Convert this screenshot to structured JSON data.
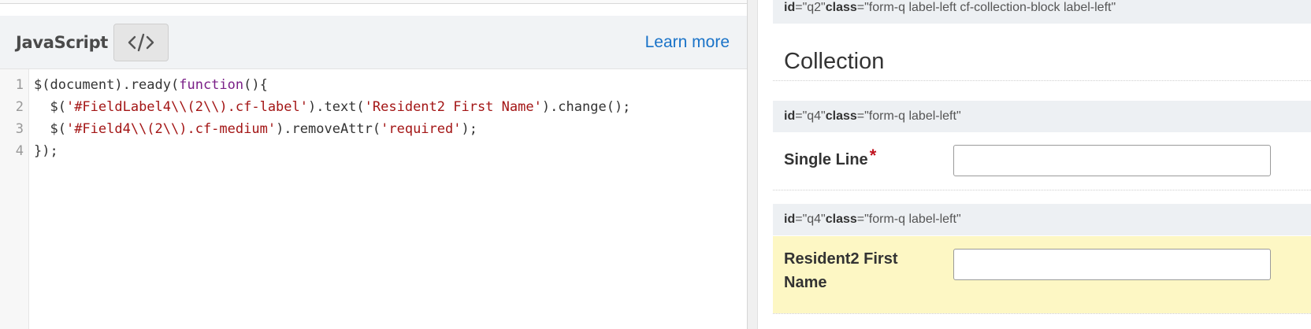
{
  "editor": {
    "title": "JavaScript",
    "toggle_icon": "code-brackets-icon",
    "learn_more": "Learn more",
    "line_numbers": [
      "1",
      "2",
      "3",
      "4"
    ],
    "lines": [
      [
        {
          "t": "$(document).ready(",
          "c": ""
        },
        {
          "t": "function",
          "c": "kw"
        },
        {
          "t": "(){",
          "c": ""
        }
      ],
      [
        {
          "t": "  $(",
          "c": ""
        },
        {
          "t": "'#FieldLabel4\\\\(2\\\\).cf-label'",
          "c": "str"
        },
        {
          "t": ").text(",
          "c": ""
        },
        {
          "t": "'Resident2 First Name'",
          "c": "str"
        },
        {
          "t": ").change();",
          "c": ""
        }
      ],
      [
        {
          "t": "  $(",
          "c": ""
        },
        {
          "t": "'#Field4\\\\(2\\\\).cf-medium'",
          "c": "str"
        },
        {
          "t": ").removeAttr(",
          "c": ""
        },
        {
          "t": "'required'",
          "c": "str"
        },
        {
          "t": ");",
          "c": ""
        }
      ],
      [
        {
          "t": "});",
          "c": ""
        }
      ]
    ]
  },
  "preview": {
    "meta_q2": {
      "id_key": "id",
      "id_val": "=\"q2\" ",
      "class_key": "class",
      "class_val": "=\"form-q label-left cf-collection-block label-left\""
    },
    "section_title": "Collection",
    "meta_q4a": {
      "id_key": "id",
      "id_val": "=\"q4\" ",
      "class_key": "class",
      "class_val": "=\"form-q label-left\""
    },
    "field1": {
      "label": "Single Line",
      "required_mark": "*",
      "value": ""
    },
    "meta_q4b": {
      "id_key": "id",
      "id_val": "=\"q4\" ",
      "class_key": "class",
      "class_val": "=\"form-q label-left\""
    },
    "field2": {
      "label_line1": "Resident2 First",
      "label_line2": "Name",
      "value": ""
    }
  },
  "colors": {
    "link": "#1a73c8",
    "keyword": "#7a1f87",
    "string": "#a31515",
    "required": "#c0131f",
    "highlight": "#fdf7c4",
    "meta_bar": "#edf0f3"
  }
}
